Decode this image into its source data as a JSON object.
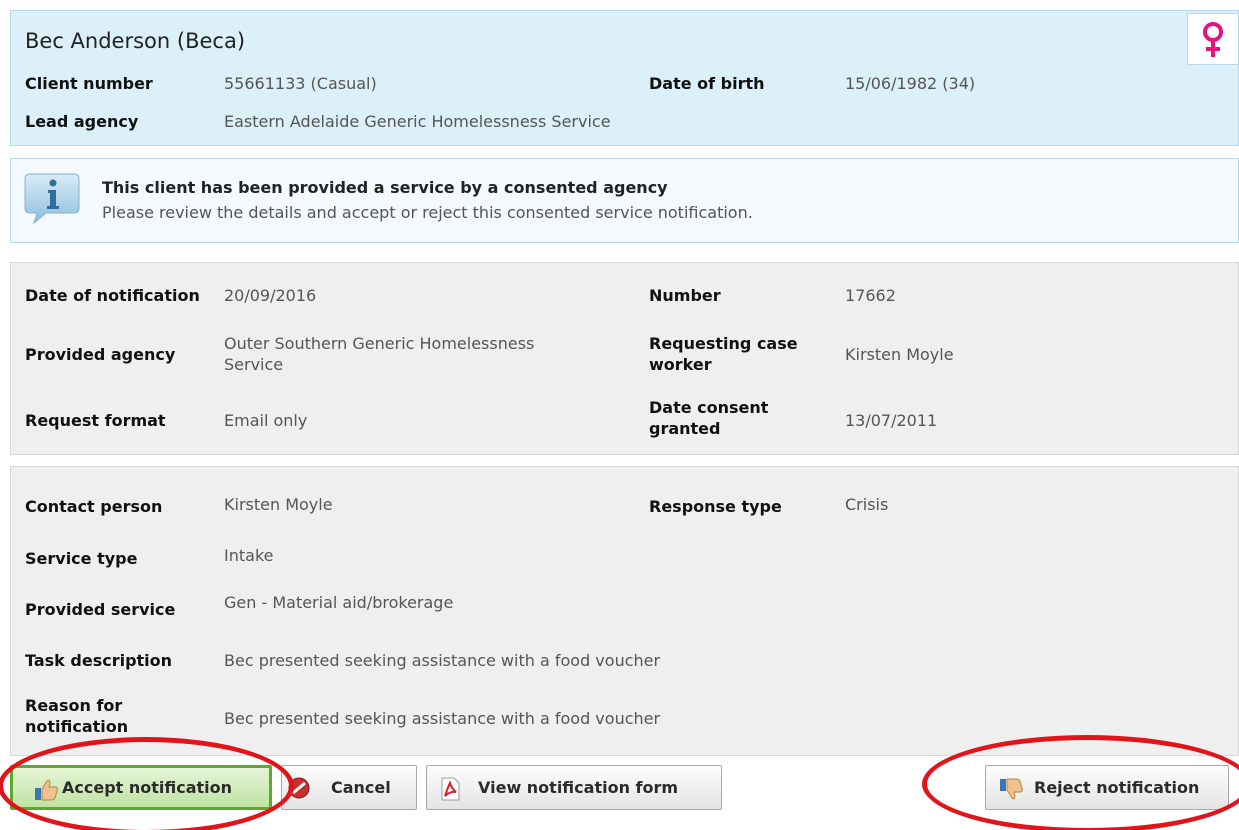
{
  "client": {
    "name": "Bec Anderson (Beca)",
    "client_number_label": "Client number",
    "client_number": "55661133 (Casual)",
    "dob_label": "Date of birth",
    "dob": "15/06/1982 (34)",
    "lead_agency_label": "Lead agency",
    "lead_agency": "Eastern Adelaide Generic Homelessness Service",
    "gender_icon": "female-icon",
    "gender_color": "#e0157f"
  },
  "info": {
    "icon": "info-icon",
    "title": "This client has been provided a service by a consented agency",
    "text": "Please review the details and accept or reject this consented service notification."
  },
  "details": {
    "date_of_notification_label": "Date of notification",
    "date_of_notification": "20/09/2016",
    "number_label": "Number",
    "number": "17662",
    "provided_agency_label": "Provided agency",
    "provided_agency_line1": "Outer Southern Generic Homelessness",
    "provided_agency_line2": "Service",
    "requesting_case_worker_label_line1": "Requesting case",
    "requesting_case_worker_label_line2": "worker",
    "requesting_case_worker": "Kirsten Moyle",
    "request_format_label": "Request format",
    "request_format": "Email only",
    "date_consent_label_line1": "Date consent",
    "date_consent_label_line2": "granted",
    "date_consent": "13/07/2011"
  },
  "service": {
    "contact_person_label": "Contact person",
    "contact_person": "Kirsten Moyle",
    "response_type_label": "Response type",
    "response_type": "Crisis",
    "service_type_label": "Service type",
    "service_type": "Intake",
    "provided_service_label": "Provided service",
    "provided_service": "Gen - Material aid/brokerage",
    "task_description_label": "Task description",
    "task_description": "Bec presented seeking assistance with a food voucher",
    "reason_label_line1": "Reason for",
    "reason_label_line2": "notification",
    "reason": "Bec presented seeking assistance with a food voucher"
  },
  "buttons": {
    "accept": "Accept notification",
    "cancel": "Cancel",
    "view_form": "View notification form",
    "reject": "Reject notification"
  },
  "annotation": {
    "highlight_color": "#e2141b"
  }
}
